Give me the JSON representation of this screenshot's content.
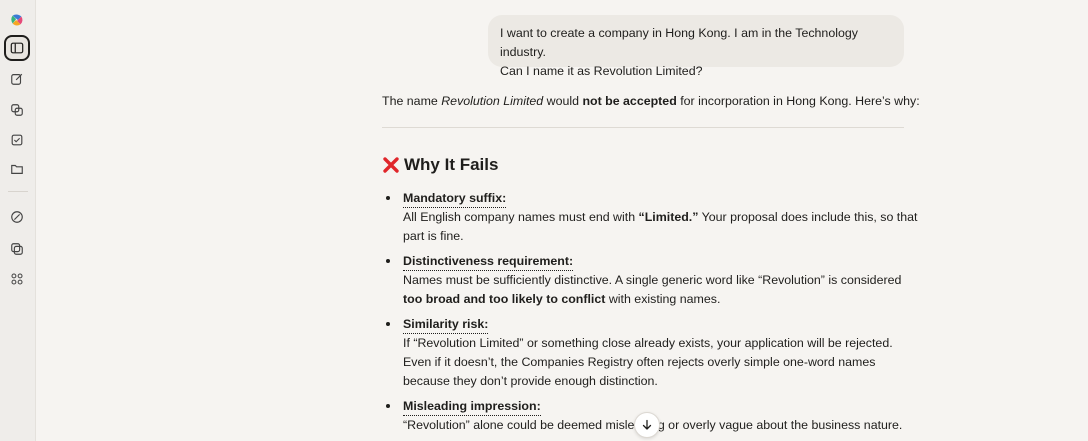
{
  "rail": {
    "icons": [
      "copilot-logo-icon",
      "sidebar-toggle-icon",
      "new-chat-icon",
      "copy-pages-icon",
      "tasks-icon",
      "folder-icon",
      "discover-icon",
      "image-gallery-icon",
      "apps-icon"
    ]
  },
  "user_message": {
    "line1": "I want to create a company in Hong Kong. I am in the Technology industry.",
    "line2": "Can I name it as Revolution Limited?"
  },
  "answer": {
    "intro_pre": "The name ",
    "intro_name": "Revolution Limited",
    "intro_mid": " would ",
    "intro_bold": "not be accepted",
    "intro_post": " for incorporation in Hong Kong. Here’s why:",
    "heading": "Why It Fails",
    "items": [
      {
        "title": "Mandatory suffix:",
        "line1_pre": "All English company names must end with ",
        "line1_bold": "“Limited.”",
        "line1_post": " Your proposal does include this, so that",
        "line2": "part is fine."
      },
      {
        "title": "Distinctiveness requirement:",
        "line1": "Names must be sufficiently distinctive. A single generic word like “Revolution” is considered",
        "line2_bold": "too broad and too likely to conflict",
        "line2_post": " with existing names."
      },
      {
        "title": "Similarity risk:",
        "line1": "If “Revolution Limited” or something close already exists, your application will be rejected.",
        "line2": "Even if it doesn’t, the Companies Registry often rejects overly simple one-word names",
        "line3": "because they don’t provide enough distinction."
      },
      {
        "title": "Misleading impression:",
        "line1": "“Revolution” alone could be deemed misleading or overly vague about the business nature."
      }
    ]
  },
  "colors": {
    "error_red": "#e0262b",
    "background": "#f6f4f1",
    "bubble": "#ece9e4"
  }
}
